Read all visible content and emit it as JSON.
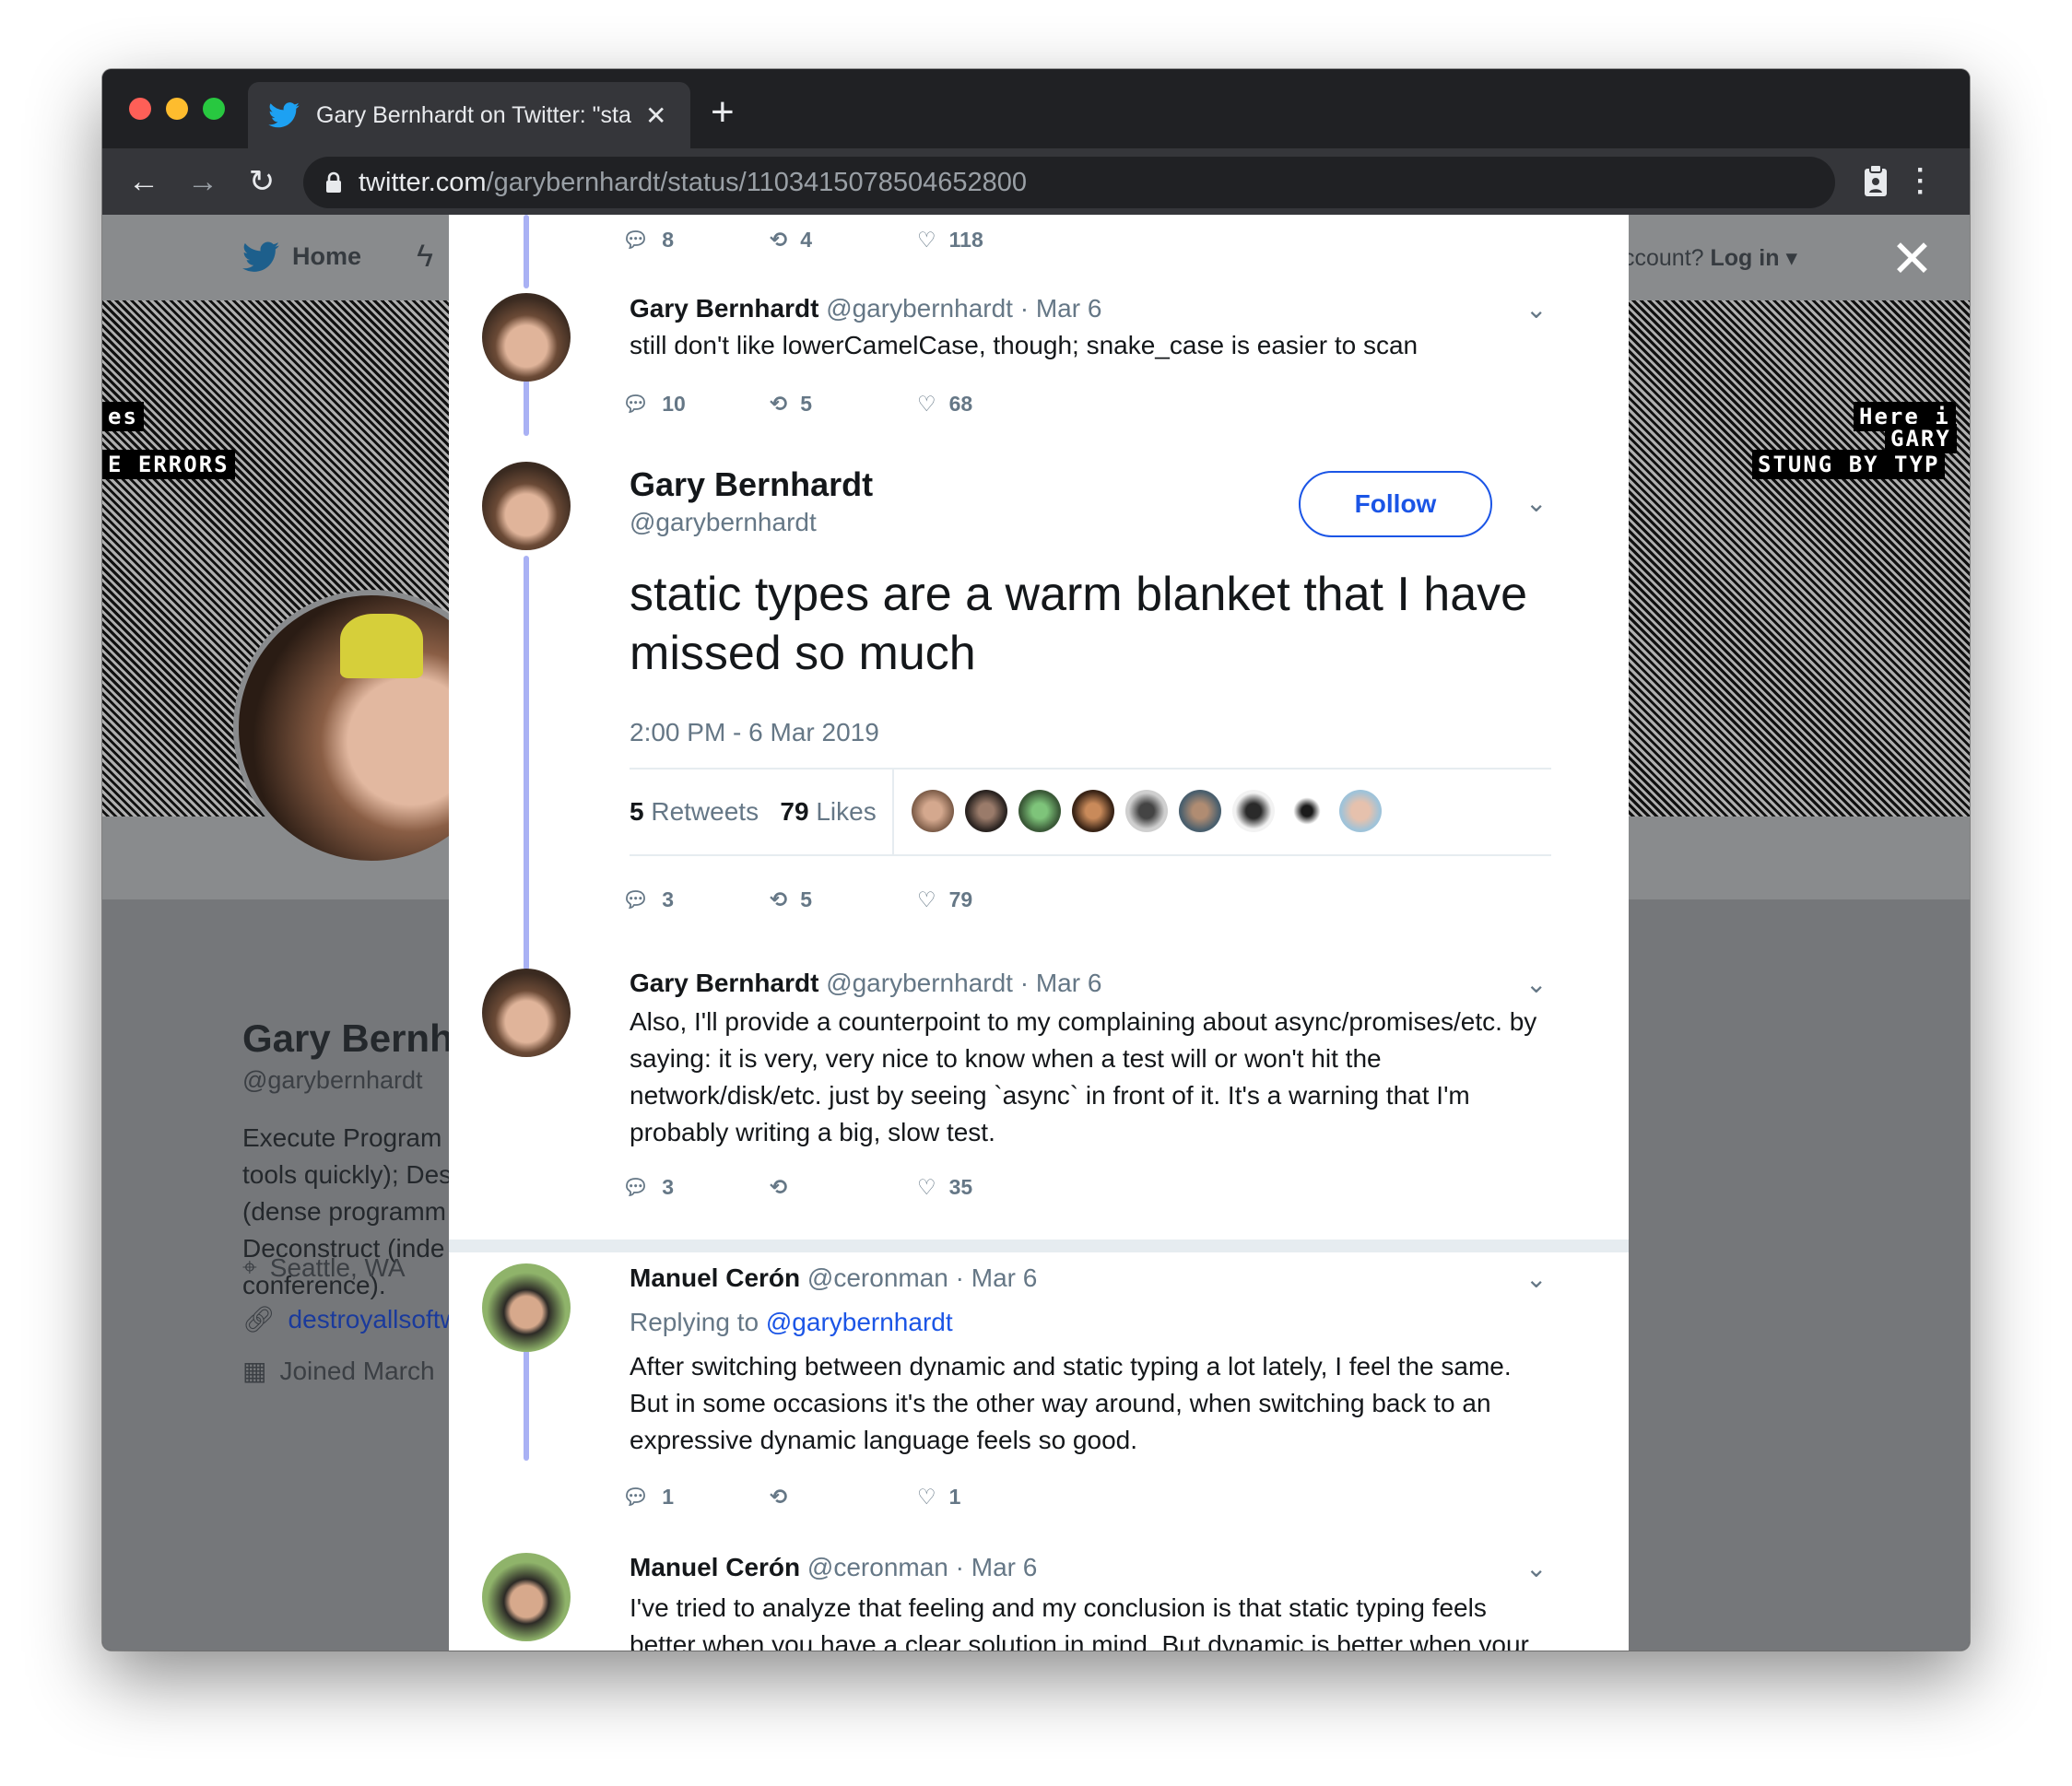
{
  "browser": {
    "tab_title": "Gary Bernhardt on Twitter: \"sta",
    "url_domain": "twitter.com",
    "url_path": "/garybernhardt/status/1103415078504652800"
  },
  "twitter_nav": {
    "home_label": "Home",
    "account_prompt": "ccount?",
    "login_label": "Log in"
  },
  "banner": {
    "text_left_1": "es",
    "text_left_2": "E ERRORS",
    "text_right_1": "Here i",
    "text_right_2": "GARY",
    "text_right_3": "STUNG BY TYP"
  },
  "profile": {
    "name": "Gary Bernh",
    "handle": "@garybernhardt",
    "bio_lines": [
      "Execute Program",
      "tools quickly); Des",
      "(dense programm",
      "Deconstruct (inde",
      "conference)."
    ],
    "location": "Seattle, WA",
    "website": "destroyallsoftw",
    "joined": "Joined March"
  },
  "modal": {
    "top_actions": {
      "replies": "8",
      "retweets": "4",
      "likes": "118"
    },
    "tweet1": {
      "name": "Gary Bernhardt",
      "handle": "@garybernhardt",
      "date": "Mar 6",
      "text": "still don't like lowerCamelCase, though; snake_case is easier to scan",
      "replies": "10",
      "retweets": "5",
      "likes": "68"
    },
    "main": {
      "name": "Gary Bernhardt",
      "handle": "@garybernhardt",
      "follow_label": "Follow",
      "text": "static types are a warm blanket that I have missed so much",
      "timestamp": "2:00 PM - 6 Mar 2019",
      "retweet_count": "5",
      "retweet_label": "Retweets",
      "like_count": "79",
      "like_label": "Likes",
      "replies": "3",
      "retweets": "5",
      "likes": "79"
    },
    "tweet2": {
      "name": "Gary Bernhardt",
      "handle": "@garybernhardt",
      "date": "Mar 6",
      "text": "Also, I'll provide a counterpoint to my complaining about async/promises/etc. by saying: it is very, very nice to know when a test will or won't hit the network/disk/etc. just by seeing `async` in front of it. It's a warning that I'm probably writing a big, slow test.",
      "replies": "3",
      "retweets": "",
      "likes": "35"
    },
    "reply1": {
      "name": "Manuel Cerón",
      "handle": "@ceronman",
      "date": "Mar 6",
      "replying_prefix": "Replying to",
      "replying_to": "@garybernhardt",
      "text": "After switching between dynamic and static typing a lot lately, I feel the same. But in some occasions it's the other way around, when switching back to an expressive dynamic language feels so good.",
      "replies": "1",
      "retweets": "",
      "likes": "1"
    },
    "reply2": {
      "name": "Manuel Cerón",
      "handle": "@ceronman",
      "date": "Mar 6",
      "text": "I've tried to analyze that feeling and my conclusion is that static typing feels better when you have a clear solution in mind. But dynamic is better when your"
    }
  },
  "colors": {
    "accent": "#1b55e6",
    "thread_line": "#a9b1f4",
    "twitter_blue": "#1da1f2"
  }
}
